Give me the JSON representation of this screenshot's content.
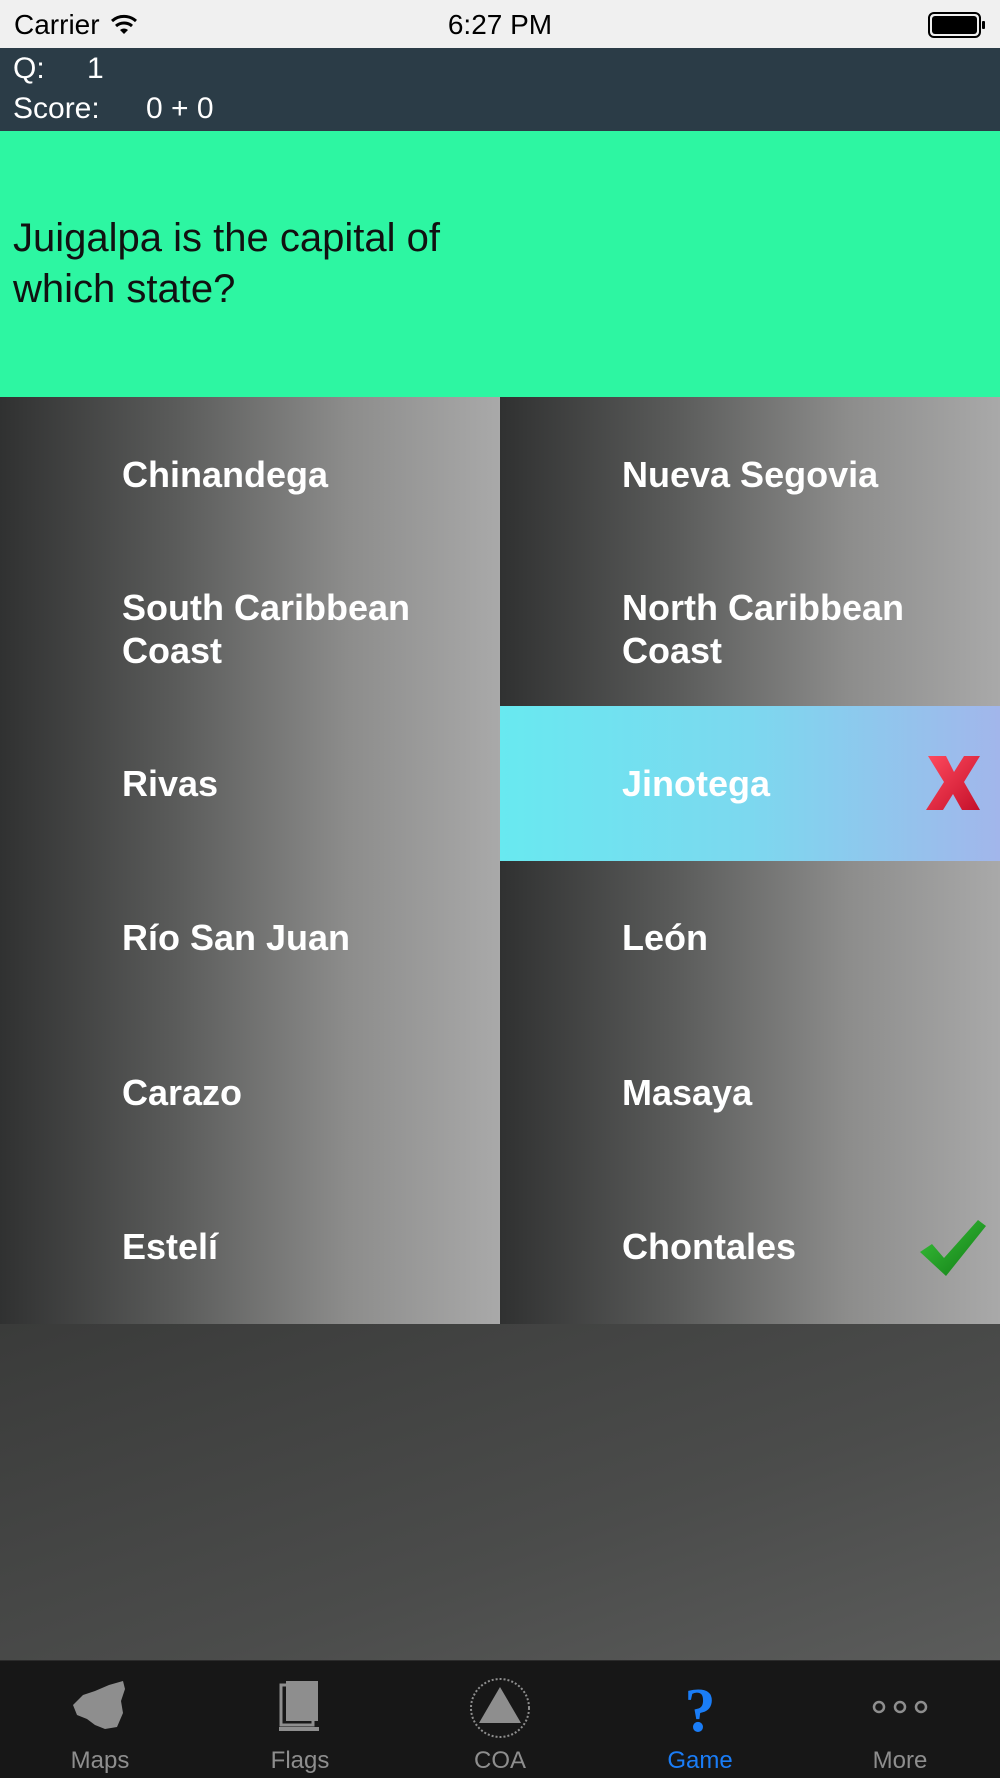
{
  "status_bar": {
    "carrier": "Carrier",
    "time": "6:27 PM"
  },
  "header": {
    "question_label": "Q:",
    "question_number": "1",
    "score_label": "Score:",
    "score_value": "0 + 0"
  },
  "question": {
    "text": "Juigalpa is the capital of which state?"
  },
  "answers": {
    "left": [
      {
        "label": "Chinandega"
      },
      {
        "label": "South Caribbean Coast"
      },
      {
        "label": "Rivas"
      },
      {
        "label": "Río San Juan"
      },
      {
        "label": "Carazo"
      },
      {
        "label": "Estelí"
      }
    ],
    "right": [
      {
        "label": "Nueva Segovia"
      },
      {
        "label": "North Caribbean Coast"
      },
      {
        "label": "Jinotega",
        "state": "wrong",
        "icon": "x-mark-icon"
      },
      {
        "label": "León"
      },
      {
        "label": "Masaya"
      },
      {
        "label": "Chontales",
        "state": "correct",
        "icon": "checkmark-icon"
      }
    ]
  },
  "tab_bar": {
    "tabs": [
      {
        "label": "Maps",
        "icon": "nicaragua-map-icon"
      },
      {
        "label": "Flags",
        "icon": "flags-icon"
      },
      {
        "label": "COA",
        "icon": "coat-of-arms-icon"
      },
      {
        "label": "Game",
        "icon": "question-mark-icon",
        "active": true
      },
      {
        "label": "More",
        "icon": "more-dots-icon"
      }
    ]
  },
  "colors": {
    "header_bg": "#2b3c47",
    "question_bg": "#2df6a2",
    "selected_answer": "#68e9f0",
    "active_tab": "#1a7df7",
    "wrong_mark": "#e0203a",
    "correct_mark": "#1e9a1e"
  }
}
